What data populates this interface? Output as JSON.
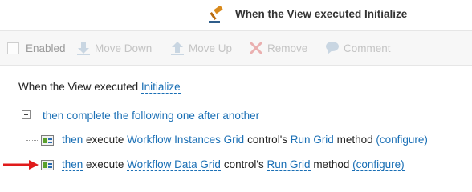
{
  "header": {
    "title": "When the View executed Initialize",
    "icon": "gavel-icon"
  },
  "toolbar": {
    "enabled_label": "Enabled",
    "move_down_label": "Move Down",
    "move_up_label": "Move Up",
    "remove_label": "Remove",
    "comment_label": "Comment",
    "enabled_checked": false
  },
  "rule": {
    "trigger_prefix": "When the View executed",
    "trigger_event": "Initialize",
    "group_text": "then complete the following one after another",
    "actions": [
      {
        "then": "then",
        "execute": "execute",
        "control": "Workflow Instances Grid",
        "control_suffix": "control's",
        "method": "Run Grid",
        "method_suffix": "method",
        "configure": "(configure)"
      },
      {
        "then": "then",
        "execute": "execute",
        "control": "Workflow Data Grid",
        "control_suffix": "control's",
        "method": "Run Grid",
        "method_suffix": "method",
        "configure": "(configure)"
      }
    ]
  },
  "colors": {
    "link": "#1a6fb5",
    "disabled_text": "#c4c4c4",
    "arrow": "#e01b1b"
  }
}
